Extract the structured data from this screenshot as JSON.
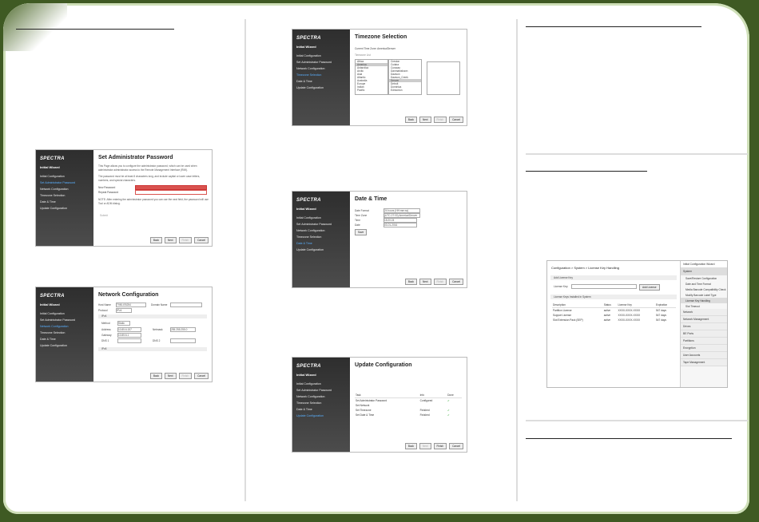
{
  "brand": {
    "logo": "SPECTRA",
    "wizard": "Initial Wizard"
  },
  "wizard_steps": [
    "Initial Configuration",
    "Set Administrator Password",
    "Network Configuration",
    "Timezone Selection",
    "Date & Time",
    "Update Configuration"
  ],
  "buttons": {
    "back": "Back",
    "next": "Next",
    "finish": "Finish",
    "cancel": "Cancel",
    "save": "Save",
    "add_license": "Add License"
  },
  "shot_password": {
    "title": "Set Administrator Password",
    "desc": "This Page allows you to configure the administrator password, which can be used when administrator administrator access to the Remote Management Interface (RMI).",
    "desc2": "The password must be at least 8 characters long, and include capital or lower case letters, numbers, and special characters.",
    "new_label": "New Password",
    "repeat_label": "Repeat Password",
    "note": "NOTE: After entering the administrator password you can use the next field, the password will use Tool or ADM dialog.",
    "submit": "Submit"
  },
  "shot_network": {
    "title": "Network Configuration",
    "host_label": "Host Name",
    "host_value": "T950-EB254",
    "domain_label": "Domain Name",
    "protocol_label": "Protocol",
    "protocol_value": "IPv4",
    "ipv4": "IPv4",
    "ipv6": "IPv6",
    "method_label": "Method",
    "method_value": "Static",
    "address_label": "Address",
    "address_value": "10.85.6.157",
    "netmask_label": "Netmask",
    "netmask_value": "255.255.255.0",
    "gateway_label": "Gateway",
    "gateway_value": "10.85.6.1",
    "dns1_label": "DNS 1",
    "dns2_label": "DNS 2"
  },
  "shot_timezone": {
    "title": "Timezone Selection",
    "current": "Current Time Zone: America/Denver",
    "list_label": "Timezone List",
    "regions": [
      "Africa",
      "America",
      "Antarctica",
      "Arctic",
      "Asia",
      "Atlantic",
      "Australia",
      "Europe",
      "Indian",
      "Pacific"
    ],
    "cities": [
      "Creston",
      "Cuiaba",
      "Curacao",
      "Danmarkshavn",
      "Dawson",
      "Dawson_Creek",
      "Denver",
      "Detroit",
      "Dominica",
      "Edmonton"
    ]
  },
  "shot_datetime": {
    "title": "Date & Time",
    "format_label": "Date Format",
    "format_value": "24 hours (HH:mm:ss)",
    "time_label": "Time",
    "time_value": "15:20:24",
    "date_label": "Date",
    "date_value": "03-01-2016",
    "tz_label": "Time Zone",
    "tz_value": "(UTC-07:00) America/Denver"
  },
  "shot_update": {
    "title": "Update Configuration",
    "headers": [
      "Task",
      "Info",
      "Done"
    ],
    "rows": [
      [
        "Set Administrator Password",
        "Configured",
        "✔"
      ],
      [
        "Set Network",
        "",
        ""
      ],
      [
        "Set Timezone",
        "Finished",
        "✔"
      ],
      [
        "Set Date & Time",
        "Finished",
        "✔"
      ]
    ]
  },
  "shot_license": {
    "breadcrumb": "Configuration > System > License Key Handling",
    "add_section": "Add License Key",
    "license_key_label": "License Key:",
    "installed_section": "License Keys Installed in System",
    "headers": [
      "Description",
      "Status",
      "License Key",
      "Expiration"
    ],
    "rows": [
      [
        "Partition License",
        "active",
        "XXXX-XXXX-XXXX",
        "547 days"
      ],
      [
        "Support License",
        "active",
        "XXXX-XXXX-XXXX",
        "547 days"
      ],
      [
        "Slot Extension Pack (SEP)",
        "active",
        "XXXX-XXXX-XXXX",
        "547 days"
      ]
    ],
    "nav": [
      "Initial Configuration Wizard",
      "System",
      "Network",
      "Network Management",
      "Drives",
      "BE Ports",
      "Partitions",
      "Encryption",
      "User Accounts",
      "Tape Management"
    ],
    "system_sub": [
      "Save/Restore Configuration",
      "Date and Time Format",
      "Media Barcode Compatibility Check",
      "Modify Barcode Label Type",
      "License Key Handling",
      "Slot Timeout"
    ]
  }
}
